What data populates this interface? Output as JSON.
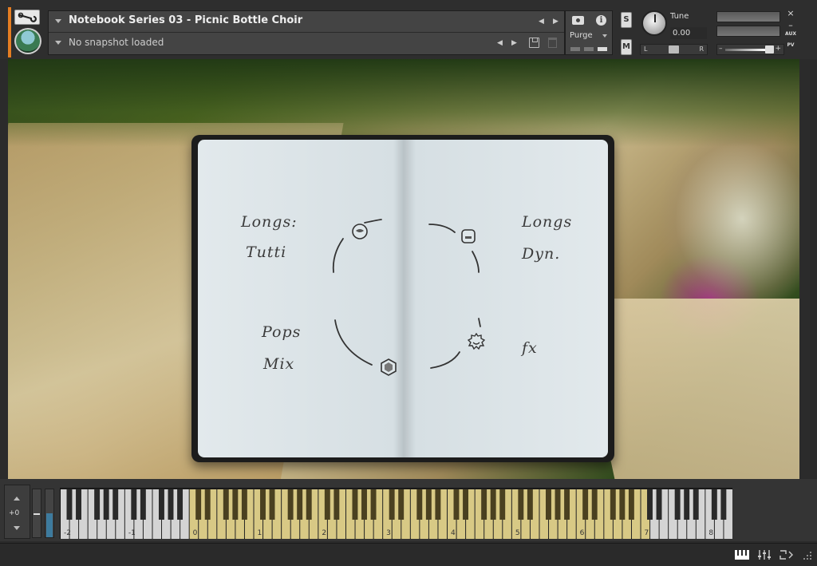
{
  "header": {
    "instrument_name": "Notebook Series 03 - Picnic Bottle Choir",
    "snapshot": "No snapshot loaded",
    "purge_label": "Purge",
    "solo_label": "S",
    "mute_label": "M",
    "tune_label": "Tune",
    "tune_value": "0.00",
    "pan_left": "L",
    "pan_right": "R",
    "aux_label": "AUX",
    "pv_label": "PV",
    "close_label": "×",
    "minimize_label": "–",
    "vol_minus": "–",
    "vol_plus": "+"
  },
  "notebook": {
    "longs_tutti_1": "Longs:",
    "longs_tutti_2": "Tutti",
    "longs_dyn_1": "Longs",
    "longs_dyn_2": "Dyn.",
    "pops_mix_1": "Pops",
    "pops_mix_2": "Mix",
    "fx": "fx"
  },
  "keyboard": {
    "octave_shift": "+0",
    "octave_labels": [
      "-2",
      "-1",
      "0",
      "1",
      "2",
      "3",
      "4",
      "5",
      "6",
      "7",
      "8"
    ],
    "active_range_start_octave": "0",
    "active_range_end_octave": "7",
    "active_color": "#d8c985"
  },
  "colors": {
    "accent": "#e67e22",
    "keyboard_active": "#d8c985"
  }
}
